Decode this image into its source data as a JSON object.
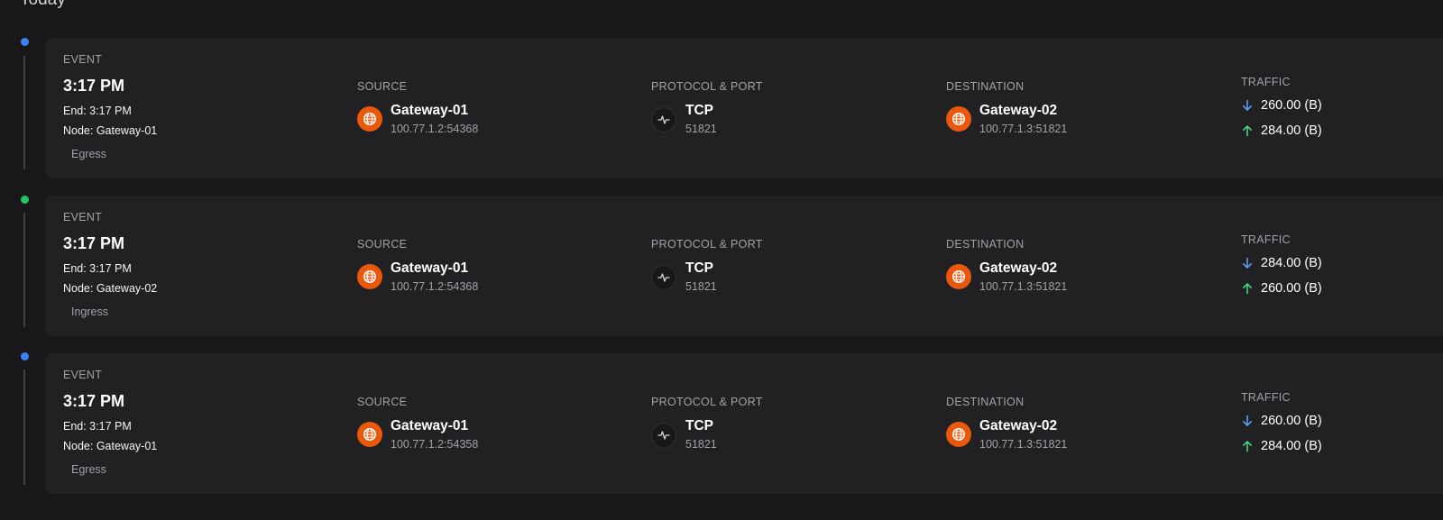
{
  "section_title": "Today",
  "labels": {
    "event": "EVENT",
    "source": "SOURCE",
    "protocol_port": "PROTOCOL & PORT",
    "destination": "DESTINATION",
    "traffic": "TRAFFIC"
  },
  "icons": {
    "source": "globe-icon",
    "protocol": "activity-icon",
    "destination": "globe-icon",
    "down": "arrow-down-icon",
    "up": "arrow-up-icon"
  },
  "colors": {
    "accent_orange": "#ea580c",
    "dot_blue": "#3b82f6",
    "dot_green": "#22c55e",
    "arrow_down": "#60a5fa",
    "arrow_up": "#4ade80"
  },
  "events": [
    {
      "status_color": "#3b82f6",
      "time": "3:17 PM",
      "end": "End: 3:17 PM",
      "node": "Node: Gateway-01",
      "direction": "Egress",
      "source_name": "Gateway-01",
      "source_addr": "100.77.1.2:54368",
      "protocol": "TCP",
      "port": "51821",
      "dest_name": "Gateway-02",
      "dest_addr": "100.77.1.3:51821",
      "traffic_down": "260.00 (B)",
      "traffic_up": "284.00 (B)"
    },
    {
      "status_color": "#22c55e",
      "time": "3:17 PM",
      "end": "End: 3:17 PM",
      "node": "Node: Gateway-02",
      "direction": "Ingress",
      "source_name": "Gateway-01",
      "source_addr": "100.77.1.2:54368",
      "protocol": "TCP",
      "port": "51821",
      "dest_name": "Gateway-02",
      "dest_addr": "100.77.1.3:51821",
      "traffic_down": "284.00 (B)",
      "traffic_up": "260.00 (B)"
    },
    {
      "status_color": "#3b82f6",
      "time": "3:17 PM",
      "end": "End: 3:17 PM",
      "node": "Node: Gateway-01",
      "direction": "Egress",
      "source_name": "Gateway-01",
      "source_addr": "100.77.1.2:54358",
      "protocol": "TCP",
      "port": "51821",
      "dest_name": "Gateway-02",
      "dest_addr": "100.77.1.3:51821",
      "traffic_down": "260.00 (B)",
      "traffic_up": "284.00 (B)"
    }
  ]
}
